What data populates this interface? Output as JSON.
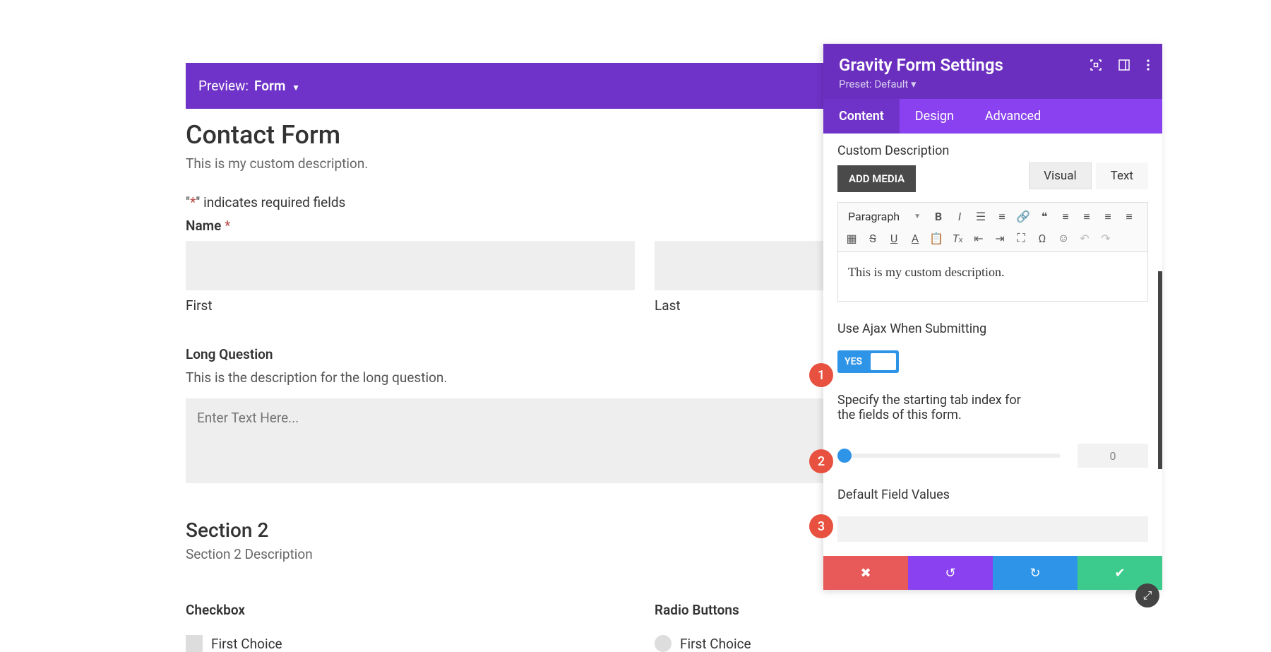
{
  "preview": {
    "label": "Preview:",
    "mode": "Form"
  },
  "form": {
    "title": "Contact Form",
    "description": "This is my custom description.",
    "required_prefix": "\"",
    "required_ast": "*",
    "required_suffix": "\" indicates required fields",
    "name_label": "Name",
    "first_label": "First",
    "last_label": "Last",
    "long_q_label": "Long Question",
    "long_q_desc": "This is the description for the long question.",
    "long_q_placeholder": "Enter Text Here...",
    "section2_title": "Section 2",
    "section2_desc": "Section 2 Description",
    "checkbox_label": "Checkbox",
    "radio_label": "Radio Buttons",
    "choice1": "First Choice"
  },
  "panel": {
    "title": "Gravity Form Settings",
    "preset": "Preset: Default ▾",
    "tabs": {
      "content": "Content",
      "design": "Design",
      "advanced": "Advanced"
    },
    "custom_desc_label": "Custom Description",
    "add_media": "ADD MEDIA",
    "editor_tabs": {
      "visual": "Visual",
      "text": "Text"
    },
    "para_label": "Paragraph",
    "editor_content": "This is my custom description.",
    "ajax_label": "Use Ajax When Submitting",
    "ajax_value": "YES",
    "tabindex_label": "Specify the starting tab index for the fields of this form.",
    "tabindex_value": "0",
    "default_values_label": "Default Field Values"
  },
  "badges": {
    "b1": "1",
    "b2": "2",
    "b3": "3"
  }
}
